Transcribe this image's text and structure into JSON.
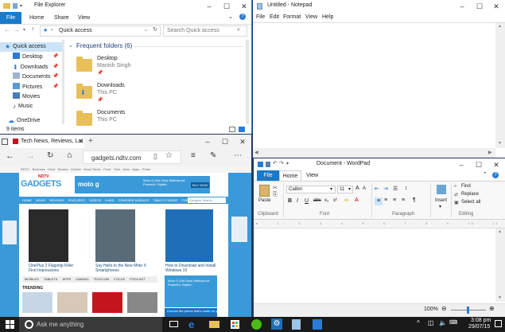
{
  "explorer": {
    "title": "File Explorer",
    "ribbon_tabs": [
      "File",
      "Home",
      "Share",
      "View"
    ],
    "address": "Quick access",
    "search_placeholder": "Search Quick access",
    "nav": [
      "Quick access",
      "Desktop",
      "Downloads",
      "Documents",
      "Pictures",
      "Movies",
      "Music",
      "OneDrive"
    ],
    "section_title": "Frequent folders (6)",
    "folders": [
      {
        "name": "Desktop",
        "sub": "Manish Singh"
      },
      {
        "name": "Downloads",
        "sub": "This PC"
      },
      {
        "name": "Documents",
        "sub": "This PC"
      }
    ],
    "status": "9 items"
  },
  "notepad": {
    "title": "Untitled - Notepad",
    "menu": [
      "File",
      "Edit",
      "Format",
      "View",
      "Help"
    ]
  },
  "edge": {
    "tab_title": "Tech News, Reviews, Lat",
    "url": "gadgets.ndtv.com",
    "site": {
      "logo_top": "NDTV",
      "logo_main": "GADGETS",
      "ad_brand": "moto g",
      "ad_headline": "Moto G (3rd Gen) Waterproof. Powerful. Stylish.",
      "ad_cta": "BUY NOW",
      "search_placeholder": "Gadgets Search",
      "nav_items": [
        "HOME",
        "NEWS",
        "REVIEWS",
        "FEATURES",
        "VIDEOS",
        "HUBS",
        "COMPARE MOBILES",
        "TABLET FINDER",
        "FORUM"
      ],
      "articles": [
        "OnePlus 2 Flagship Killer First Impressions",
        "Say Hello to the New Moto X Smartphones",
        "How to Download and Install Windows 10"
      ],
      "categories": [
        "MOBILES",
        "TABLETS",
        "APPS",
        "GAMING",
        "TELECOM",
        "FOCUS",
        "PODCAST"
      ],
      "section": "TRENDING",
      "ad2": "Moto G (3rd Gen) Waterproof. Powerful. Stylish.",
      "ad3": "Choose the phone that's made for you",
      "ad3_cta": "BUY NOW"
    }
  },
  "wordpad": {
    "title": "Document - WordPad",
    "tabs": [
      "File",
      "Home",
      "View"
    ],
    "font": "Calibri",
    "size": "11",
    "groups": [
      "Clipboard",
      "Font",
      "Paragraph",
      "Editing"
    ],
    "paste": "Paste",
    "insert": "Insert",
    "editing_items": [
      "Find",
      "Replace",
      "Select all"
    ],
    "zoom": "100%"
  },
  "taskbar": {
    "search_placeholder": "Ask me anything",
    "time": "3:08 pm",
    "date": "29/07/15"
  },
  "colors": {
    "accent": "#2b7bd6",
    "edge_bar": "#f2f2f2",
    "taskbar": "#1a1a1a",
    "ndtv_red": "#c4161c",
    "ndtv_blue": "#3a9ad9"
  }
}
